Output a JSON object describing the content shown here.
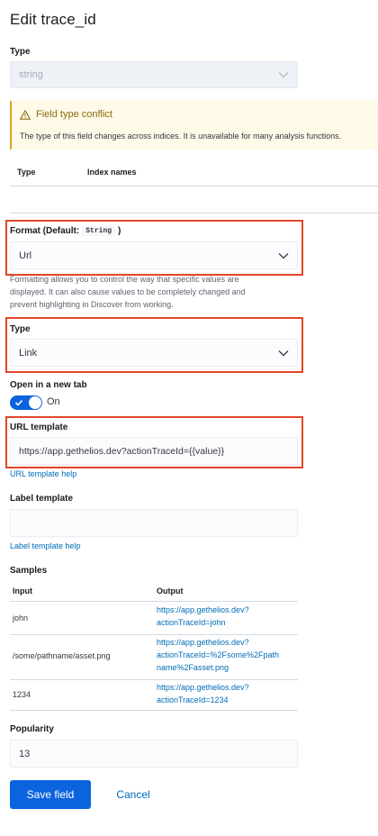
{
  "title": "Edit trace_id",
  "type_section": {
    "label": "Type",
    "value": "string"
  },
  "callout": {
    "title": "Field type conflict",
    "body": "The type of this field changes across indices. It is unavailable for many analysis functions."
  },
  "conflict_table": {
    "headers": [
      "Type",
      "Index names"
    ]
  },
  "format": {
    "label_prefix": "Format (Default:",
    "default_code": "String",
    "label_suffix": ")",
    "value": "Url",
    "help": [
      "Formatting allows you to control the way that specific values are",
      "displayed. It can also cause values to be completely changed and",
      "prevent highlighting in Discover from working."
    ]
  },
  "link_type": {
    "label": "Type",
    "value": "Link"
  },
  "new_tab": {
    "label": "Open in a new tab",
    "state": "On"
  },
  "url_template": {
    "label": "URL template",
    "value": "https://app.gethelios.dev?actionTraceId={{value}}",
    "help_link": "URL template help"
  },
  "label_template": {
    "label": "Label template",
    "value": "",
    "help_link": "Label template help"
  },
  "samples": {
    "label": "Samples",
    "headers": [
      "Input",
      "Output"
    ],
    "rows": [
      {
        "input": "john",
        "output": [
          "https://app.gethelios.dev?",
          "actionTraceId=john"
        ]
      },
      {
        "input": "/some/pathname/asset.png",
        "output": [
          "https://app.gethelios.dev?",
          "actionTraceId=%2Fsome%2Fpath",
          "name%2Fasset.png"
        ]
      },
      {
        "input": "1234",
        "output": [
          "https://app.gethelios.dev?",
          "actionTraceId=1234"
        ]
      }
    ]
  },
  "popularity": {
    "label": "Popularity",
    "value": "13"
  },
  "buttons": {
    "save": "Save field",
    "cancel": "Cancel"
  },
  "colors": {
    "primary": "#0b64dd",
    "link": "#006bb8",
    "highlight": "#e2452a",
    "warning": "#d8a72a"
  }
}
